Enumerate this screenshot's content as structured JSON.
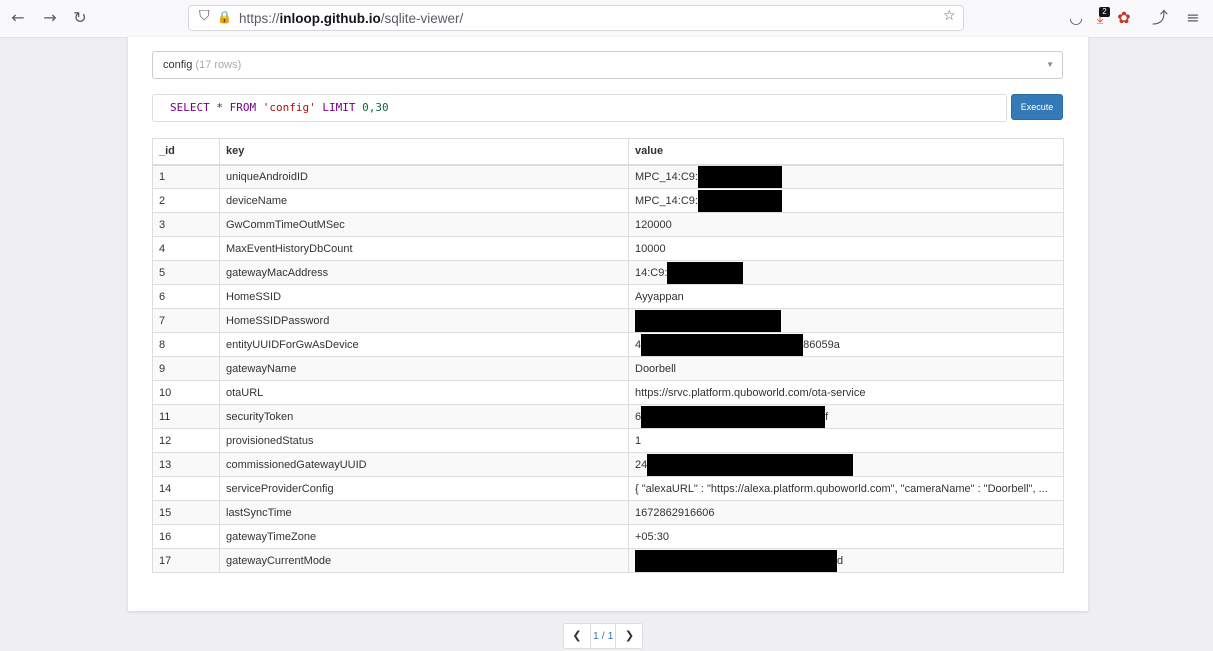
{
  "browser": {
    "url_prefix": "https://",
    "url_host": "inloop.github.io",
    "url_path": "/sqlite-viewer/",
    "extension_badge": "2",
    "icons": {
      "back": "←",
      "forward": "→",
      "reload": "↻",
      "shield": "⛉",
      "lock": "🔒",
      "star": "☆",
      "pocket": "◡",
      "download": "⤓",
      "extension": "✿",
      "share": "⤴",
      "menu": "≡"
    }
  },
  "table_select": {
    "name": "config",
    "rows_text": "(17 rows)",
    "caret": "▼"
  },
  "query": {
    "kw1": "SELECT",
    "star": "*",
    "kw2": "FROM",
    "table": "'config'",
    "kw3": "LIMIT",
    "limit": "0,30"
  },
  "execute_label": "Execute",
  "columns": [
    "_id",
    "key",
    "value"
  ],
  "rows": [
    {
      "id": "1",
      "key": "uniqueAndroidID",
      "value": "MPC_14:C9:",
      "redact_w": 84,
      "suffix": ""
    },
    {
      "id": "2",
      "key": "deviceName",
      "value": "MPC_14:C9:",
      "redact_w": 84,
      "suffix": ""
    },
    {
      "id": "3",
      "key": "GwCommTimeOutMSec",
      "value": "120000",
      "redact_w": 0,
      "suffix": ""
    },
    {
      "id": "4",
      "key": "MaxEventHistoryDbCount",
      "value": "10000",
      "redact_w": 0,
      "suffix": ""
    },
    {
      "id": "5",
      "key": "gatewayMacAddress",
      "value": "14:C9:",
      "redact_w": 76,
      "suffix": ""
    },
    {
      "id": "6",
      "key": "HomeSSID",
      "value": "Ayyappan",
      "redact_w": 0,
      "suffix": ""
    },
    {
      "id": "7",
      "key": "HomeSSIDPassword",
      "value": "",
      "redact_w": 146,
      "suffix": ""
    },
    {
      "id": "8",
      "key": "entityUUIDForGwAsDevice",
      "value": "4",
      "redact_w": 162,
      "suffix": "86059a"
    },
    {
      "id": "9",
      "key": "gatewayName",
      "value": "Doorbell",
      "redact_w": 0,
      "suffix": ""
    },
    {
      "id": "10",
      "key": "otaURL",
      "value": "https://srvc.platform.quboworld.com/ota-service",
      "redact_w": 0,
      "suffix": ""
    },
    {
      "id": "11",
      "key": "securityToken",
      "value": "6",
      "redact_w": 184,
      "suffix": "f"
    },
    {
      "id": "12",
      "key": "provisionedStatus",
      "value": "1",
      "redact_w": 0,
      "suffix": ""
    },
    {
      "id": "13",
      "key": "commissionedGatewayUUID",
      "value": "24",
      "redact_w": 206,
      "suffix": ""
    },
    {
      "id": "14",
      "key": "serviceProviderConfig",
      "value": "{ \"alexaURL\" : \"https://alexa.platform.quboworld.com\", \"cameraName\" : \"Doorbell\", ...",
      "redact_w": 0,
      "suffix": ""
    },
    {
      "id": "15",
      "key": "lastSyncTime",
      "value": "1672862916606",
      "redact_w": 0,
      "suffix": ""
    },
    {
      "id": "16",
      "key": "gatewayTimeZone",
      "value": "+05:30",
      "redact_w": 0,
      "suffix": ""
    },
    {
      "id": "17",
      "key": "gatewayCurrentMode",
      "value": "",
      "redact_w": 202,
      "suffix": "d"
    }
  ],
  "pager": {
    "prev": "❮",
    "info": "1 / 1",
    "next": "❯"
  }
}
